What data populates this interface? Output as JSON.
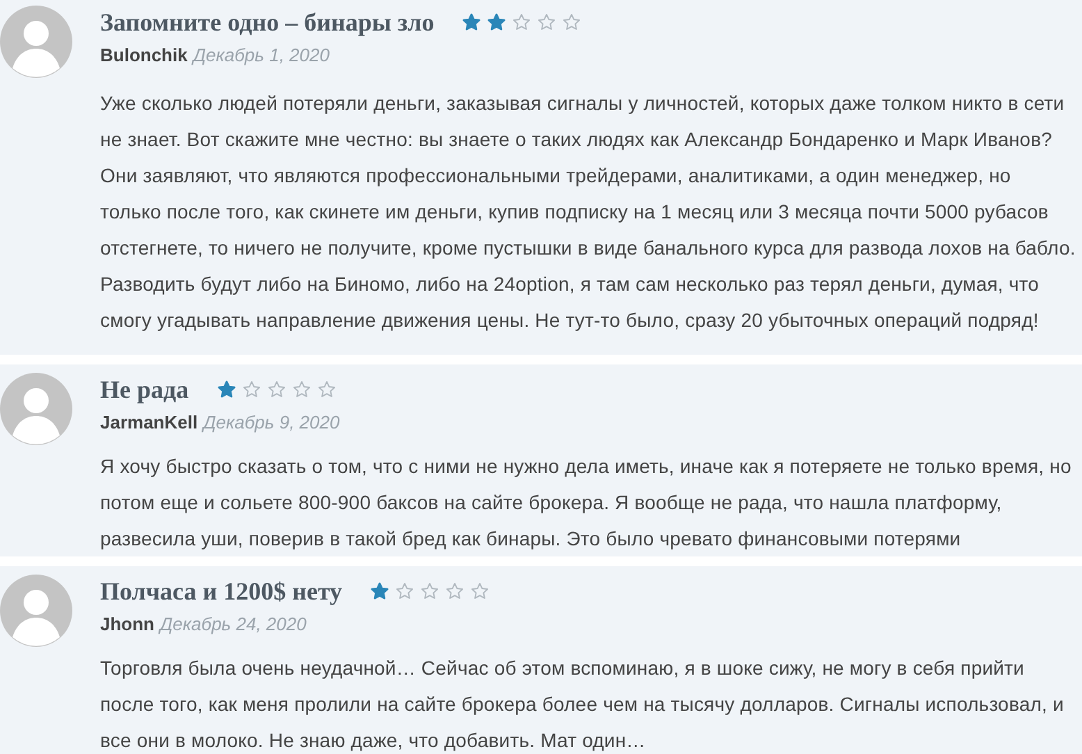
{
  "reviews": [
    {
      "title": "Запомните одно – бинары зло",
      "stars": 2,
      "author": "Bulonchik",
      "date": "Декабрь 1, 2020",
      "text": "Уже сколько людей потеряли деньги, заказывая сигналы у личностей, которых даже толком никто в сети не знает. Вот скажите мне честно: вы знаете о таких людях как Александр Бондаренко и Марк Иванов? Они заявляют, что являются профессиональными трейдерами, аналитиками, а один менеджер, но только после того, как скинете им деньги, купив подписку на 1 месяц или 3 месяца почти 5000 рубасов отстегнете, то ничего не получите, кроме пустышки в виде банального курса для развода лохов на бабло. Разводить будут либо на Биномо, либо на 24option, я там сам несколько раз терял деньги, думая, что смогу угадывать направление движения цены. Не тут-то было, сразу 20 убыточных операций подряд!"
    },
    {
      "title": "Не рада",
      "stars": 1,
      "author": "JarmanKell",
      "date": "Декабрь 9, 2020",
      "text": "Я хочу быстро сказать о том, что с ними не нужно дела иметь, иначе как я потеряете не только время, но потом еще и сольете 800-900 баксов на сайте брокера. Я вообще не рада, что нашла платформу, развесила уши, поверив в такой бред как бинары. Это было чревато финансовыми потерями"
    },
    {
      "title": "Полчаса и 1200$ нету",
      "stars": 1,
      "author": "Jhonn",
      "date": "Декабрь 24, 2020",
      "text": "Торговля была очень неудачной… Сейчас об этом вспоминаю, я в шоке сижу, не могу в себя прийти после того, как меня пролили на сайте брокера более чем на тысячу долларов. Сигналы использовал, и все они в молоко. Не знаю даже, что добавить. Мат один…"
    }
  ]
}
